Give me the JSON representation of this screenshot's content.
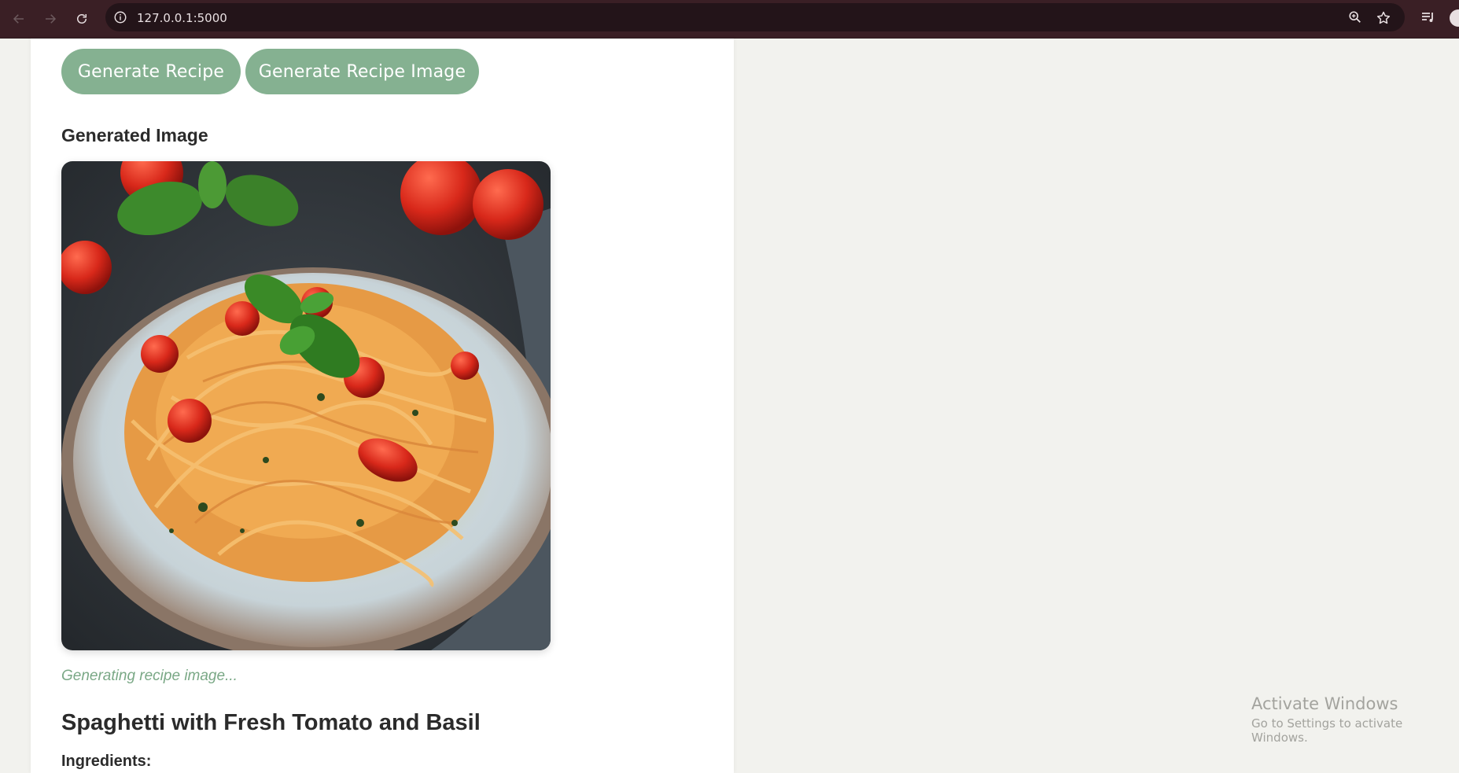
{
  "browser": {
    "url": "127.0.0.1:5000"
  },
  "actions": {
    "generate_recipe_label": "Generate Recipe",
    "generate_image_label": "Generate Recipe Image"
  },
  "image_section": {
    "title": "Generated Image",
    "image_alt_icon": "spaghetti-dish-image",
    "status": "Generating recipe image..."
  },
  "recipe": {
    "title": "Spaghetti with Fresh Tomato and Basil",
    "ingredients_heading": "Ingredients:"
  },
  "watermark": {
    "title": "Activate Windows",
    "subtitle": "Go to Settings to activate Windows."
  },
  "colors": {
    "accent": "#85b191",
    "status_text": "#7aa886",
    "chrome": "#3a1f25"
  }
}
